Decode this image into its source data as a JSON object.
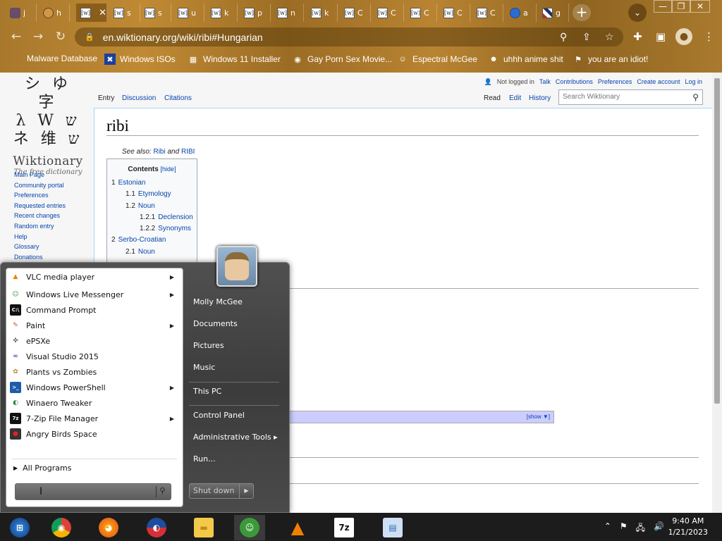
{
  "browser": {
    "tabs": [
      {
        "letter": "j",
        "favicon": "anime-avatar"
      },
      {
        "letter": "h",
        "favicon": "red-oval"
      },
      {
        "letter": "",
        "favicon": "wiktionary-w",
        "active": true
      },
      {
        "letter": "s",
        "favicon": "wiktionary-w"
      },
      {
        "letter": "s",
        "favicon": "wiktionary-w"
      },
      {
        "letter": "u",
        "favicon": "wiktionary-w"
      },
      {
        "letter": "k",
        "favicon": "wiktionary-w"
      },
      {
        "letter": "p",
        "favicon": "wiktionary-w"
      },
      {
        "letter": "n",
        "favicon": "wiktionary-w"
      },
      {
        "letter": "k",
        "favicon": "wiktionary-w"
      },
      {
        "letter": "C",
        "favicon": "wiktionary-w"
      },
      {
        "letter": "C",
        "favicon": "wiktionary-w"
      },
      {
        "letter": "C",
        "favicon": "wiktionary-w"
      },
      {
        "letter": "C",
        "favicon": "wiktionary-w"
      },
      {
        "letter": "C",
        "favicon": "wiktionary-w"
      },
      {
        "letter": "a",
        "favicon": "blue-globe"
      },
      {
        "letter": "g",
        "favicon": "union-jack"
      }
    ],
    "favicon_glyph": "[w]",
    "new_tab_label": "+",
    "url": "en.wiktionary.org/wiki/ribi#Hungarian",
    "bookmarks": [
      {
        "label": "Malware Database",
        "icon": "none"
      },
      {
        "label": "Windows ISOs",
        "icon": "x-icon"
      },
      {
        "label": "Windows 11 Installer",
        "icon": "image-icon"
      },
      {
        "label": "Gay Porn Sex Movie...",
        "icon": "globe-icon"
      },
      {
        "label": "Espectral McGee",
        "icon": "avatar-icon"
      },
      {
        "label": "uhhh anime shit",
        "icon": "anime-icon"
      },
      {
        "label": "you are an idiot!",
        "icon": "flag-icon"
      }
    ]
  },
  "wiki": {
    "logo_glyphs_row1": "シ ゆ 字",
    "logo_glyphs_row2": "λ W ש",
    "logo_glyphs_row3": "ネ 维 ש",
    "wordmark": "Wiktionary",
    "tagline": "The free dictionary",
    "sidenav": [
      "Main Page",
      "Community portal",
      "Preferences",
      "Requested entries",
      "Recent changes",
      "Random entry",
      "Help",
      "Glossary",
      "Donations"
    ],
    "personal": [
      "Not logged in",
      "Talk",
      "Contributions",
      "Preferences",
      "Create account",
      "Log in"
    ],
    "tabs": {
      "entry": "Entry",
      "discussion": "Discussion",
      "citations": "Citations",
      "read": "Read",
      "edit": "Edit",
      "history": "History"
    },
    "search_placeholder": "Search Wiktionary",
    "title": "ribi",
    "see_also_prefix": "See also:",
    "see_also_a": "Ribi",
    "see_also_and": "and",
    "see_also_b": "RIBI",
    "toc_title": "Contents",
    "toc_hide": "[hide]",
    "toc": [
      {
        "num": "1",
        "label": "Estonian",
        "level": 0
      },
      {
        "num": "1.1",
        "label": "Etymology",
        "level": 1
      },
      {
        "num": "1.2",
        "label": "Noun",
        "level": 1
      },
      {
        "num": "1.2.1",
        "label": "Declension",
        "level": 2
      },
      {
        "num": "1.2.2",
        "label": "Synonyms",
        "level": 2
      },
      {
        "num": "2",
        "label": "Serbo-Croatian",
        "level": 0
      },
      {
        "num": "2.1",
        "label": "Noun",
        "level": 1
      }
    ],
    "navbox_show": "[show ▼]"
  },
  "startmenu": {
    "programs": [
      {
        "label": "VLC media player",
        "icon": "vlc-icon",
        "submenu": true
      },
      {
        "label": "Windows Live Messenger",
        "icon": "messenger-icon",
        "submenu": true
      },
      {
        "label": "Command Prompt",
        "icon": "cmd-icon",
        "submenu": false
      },
      {
        "label": "Paint",
        "icon": "paint-icon",
        "submenu": true
      },
      {
        "label": "ePSXe",
        "icon": "gamepad-icon",
        "submenu": false
      },
      {
        "label": "Visual Studio 2015",
        "icon": "visual-studio-icon",
        "submenu": false
      },
      {
        "label": "Plants vs Zombies",
        "icon": "pvz-icon",
        "submenu": false
      },
      {
        "label": "Windows PowerShell",
        "icon": "powershell-icon",
        "submenu": true
      },
      {
        "label": "Winaero Tweaker",
        "icon": "winaero-icon",
        "submenu": false
      },
      {
        "label": "7-Zip File Manager",
        "icon": "7zip-icon",
        "submenu": true
      },
      {
        "label": "Angry Birds Space",
        "icon": "angry-birds-icon",
        "submenu": false
      }
    ],
    "all_programs": "All Programs",
    "right_links": [
      {
        "label": "Molly McGee"
      },
      {
        "label": "Documents"
      },
      {
        "label": "Pictures"
      },
      {
        "label": "Music"
      },
      {
        "label": "This PC"
      },
      {
        "label": "Control Panel"
      },
      {
        "label": "Administrative Tools",
        "submenu": true
      },
      {
        "label": "Run..."
      }
    ],
    "shutdown": "Shut down"
  },
  "taskbar": {
    "apps": [
      "start-orb-icon",
      "chrome-icon",
      "firefox-icon",
      "obama-logo-icon",
      "file-explorer-icon",
      "messenger-icon",
      "vlc-icon",
      "7zip-icon",
      "task-manager-icon"
    ],
    "time": "9:40 AM",
    "date": "1/21/2023"
  }
}
